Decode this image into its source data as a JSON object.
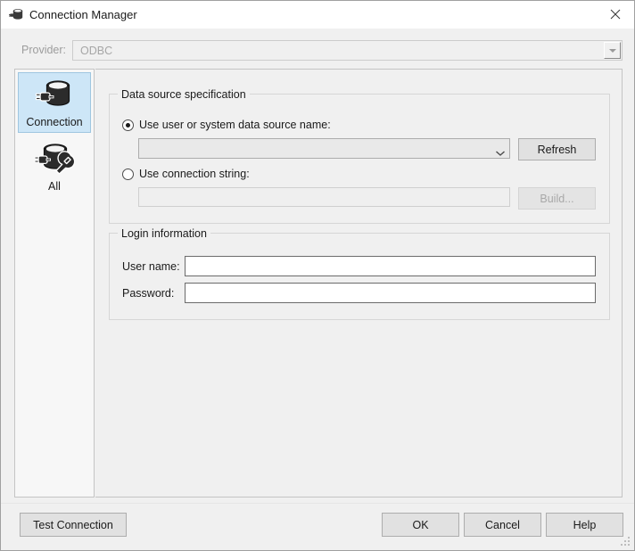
{
  "window": {
    "title": "Connection Manager",
    "title_icon": "database-plug-icon",
    "close_icon": "close-icon"
  },
  "provider": {
    "label": "Provider:",
    "value": "ODBC",
    "arrow_icon": "triangle-down-icon",
    "disabled": true
  },
  "sidebar": {
    "items": [
      {
        "label": "Connection",
        "icon": "database-plug-icon",
        "selected": true
      },
      {
        "label": "All",
        "icon": "database-wrench-icon",
        "selected": false
      }
    ]
  },
  "data_source_group": {
    "title": "Data source specification",
    "radio_dsn": {
      "label": "Use user or system data source name:",
      "checked": true
    },
    "dsn_combo": {
      "value": "",
      "placeholder": "",
      "arrow_icon": "chevron-down-icon",
      "disabled": false
    },
    "refresh_button": {
      "label": "Refresh",
      "disabled": false
    },
    "radio_connstring": {
      "label": "Use connection string:",
      "checked": false
    },
    "connstring_input": {
      "value": "",
      "placeholder": "",
      "disabled": true
    },
    "build_button": {
      "label": "Build...",
      "disabled": true
    }
  },
  "login_group": {
    "title": "Login information",
    "username": {
      "label": "User name:",
      "value": "",
      "placeholder": ""
    },
    "password": {
      "label": "Password:",
      "value": "",
      "placeholder": ""
    }
  },
  "footer": {
    "test_connection_label": "Test Connection",
    "ok_label": "OK",
    "cancel_label": "Cancel",
    "help_label": "Help",
    "grip_icon": "resize-grip-icon"
  },
  "colors": {
    "window_bg": "#f0f0f0",
    "titlebar_bg": "#ffffff",
    "selection_blue": "#cde6f7",
    "selection_border": "#9fc6e0",
    "disabled_text": "#a0a0a0",
    "text": "#1a1a1a",
    "button_bg": "#e1e1e1",
    "button_border": "#adadad"
  }
}
